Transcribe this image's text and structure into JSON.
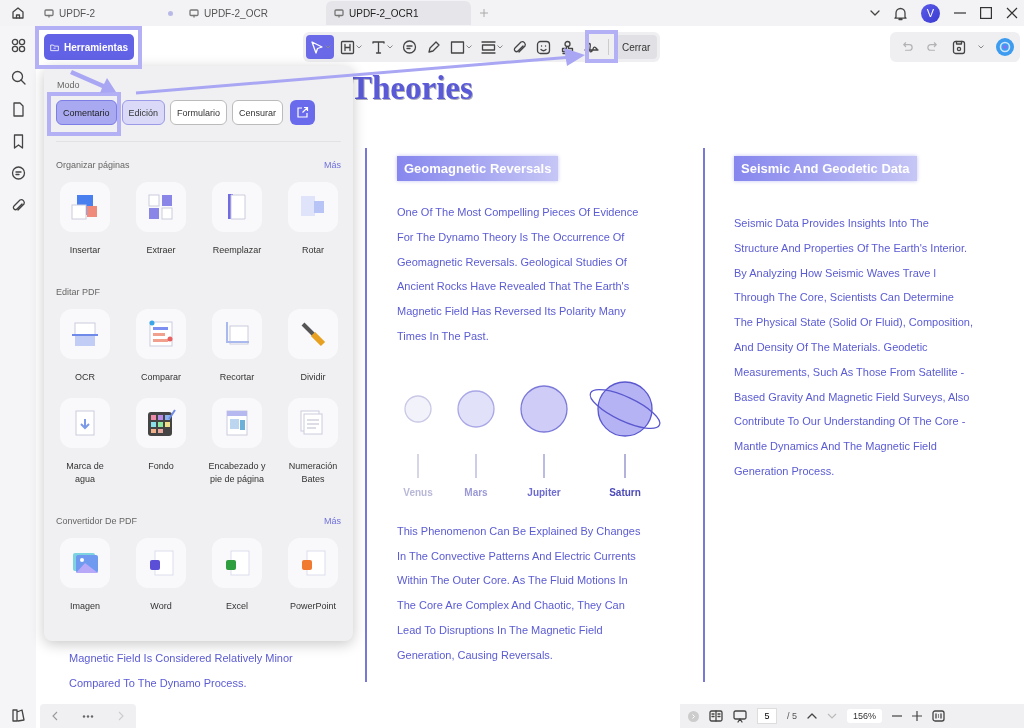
{
  "tabs": [
    {
      "label": "UPDF-2",
      "selected": false,
      "unsaved": true
    },
    {
      "label": "UPDF-2_OCR",
      "selected": false,
      "unsaved": false
    },
    {
      "label": "UPDF-2_OCR1",
      "selected": true,
      "unsaved": false
    }
  ],
  "account": {
    "initial": "V"
  },
  "tools_button": {
    "label": "Herramientas"
  },
  "toolbar": {
    "tools": [
      {
        "selected": true,
        "dropdown": true
      },
      {
        "selected": false,
        "dropdown": true
      },
      {
        "selected": false,
        "dropdown": true
      },
      {
        "selected": false,
        "dropdown": false
      },
      {
        "selected": false,
        "dropdown": false
      },
      {
        "selected": false,
        "dropdown": true
      },
      {
        "selected": false,
        "dropdown": true
      },
      {
        "selected": false,
        "dropdown": false
      },
      {
        "selected": false,
        "dropdown": false
      },
      {
        "selected": false,
        "dropdown": false
      },
      {
        "selected": false,
        "dropdown": false
      }
    ],
    "close_label": "Cerrar"
  },
  "history": [
    {
      "disabled": true
    },
    {
      "disabled": true
    }
  ],
  "document": {
    "title": "Theories",
    "left_lines": [
      "Magnetic Field Is Considered Relatively Minor",
      "Compared To The Dynamo Process."
    ],
    "columns": [
      {
        "heading": "Geomagnetic Reversals",
        "blocks": [
          {
            "kind": "text",
            "lines": [
              "One Of The Most Compelling Pieces Of Evidence",
              "For The Dynamo Theory Is The Occurrence Of",
              "Geomagnetic Reversals. Geological Studies Of",
              "Ancient Rocks Have Revealed That The Earth's",
              "Magnetic Field Has Reversed Its Polarity Many",
              "Times In The Past."
            ]
          },
          {
            "kind": "planets",
            "labels": [
              "Venus",
              "Mars",
              "Jupiter",
              "Saturn"
            ]
          },
          {
            "kind": "text",
            "lines": [
              "This Phenomenon Can Be Explained By Changes",
              "In The Convective Patterns And Electric Currents",
              "Within The Outer Core. As The Fluid Motions In",
              "The Core Are Complex And Chaotic, They Can",
              "Lead To Disruptions In The Magnetic Field",
              "Generation, Causing Reversals."
            ]
          }
        ]
      },
      {
        "heading": "Seismic And Geodetic Data",
        "blocks": [
          {
            "kind": "text",
            "lines": [
              "Seismic Data Provides Insights Into The",
              "Structure And Properties Of The Earth's Interior.",
              "By Analyzing How Seismic Waves Trave l",
              "Through The Core, Scientists Can Determine",
              "The Physical State (Solid Or Fluid), Composition,",
              "And Density Of The Materials. Geodetic",
              "Measurements, Such As Those From Satellite -",
              "Based Gravity And Magnetic Field Surveys, Also",
              "Contribute To Our Understanding Of The Core -",
              "Mantle Dynamics And The Magnetic Field",
              "Generation Process."
            ]
          }
        ]
      }
    ]
  },
  "panel": {
    "mode_label": "Modo",
    "modes": [
      {
        "label": "Comentario",
        "selected": true,
        "hovered": false
      },
      {
        "label": "Edición",
        "selected": false,
        "hovered": true
      },
      {
        "label": "Formulario",
        "selected": false,
        "hovered": false
      },
      {
        "label": "Censurar",
        "selected": false,
        "hovered": false
      }
    ],
    "sections": [
      {
        "title": "Organizar páginas",
        "more": "Más",
        "items": [
          {
            "label": "Insertar"
          },
          {
            "label": "Extraer"
          },
          {
            "label": "Reemplazar"
          },
          {
            "label": "Rotar"
          }
        ]
      },
      {
        "title": "Editar PDF",
        "items": [
          {
            "label": "OCR"
          },
          {
            "label": "Comparar"
          },
          {
            "label": "Recortar"
          },
          {
            "label": "Dividir"
          },
          {
            "label": "Marca de agua"
          },
          {
            "label": "Fondo"
          },
          {
            "label": "Encabezado y pie de página"
          },
          {
            "label": "Numeración Bates"
          }
        ]
      },
      {
        "title": "Convertidor De PDF",
        "more": "Más",
        "items": [
          {
            "label": "Imagen"
          },
          {
            "label": "Word"
          },
          {
            "label": "Excel"
          },
          {
            "label": "PowerPoint"
          }
        ]
      }
    ]
  },
  "pager": {
    "page": "5",
    "total": "/ 5",
    "zoom": "156%"
  }
}
